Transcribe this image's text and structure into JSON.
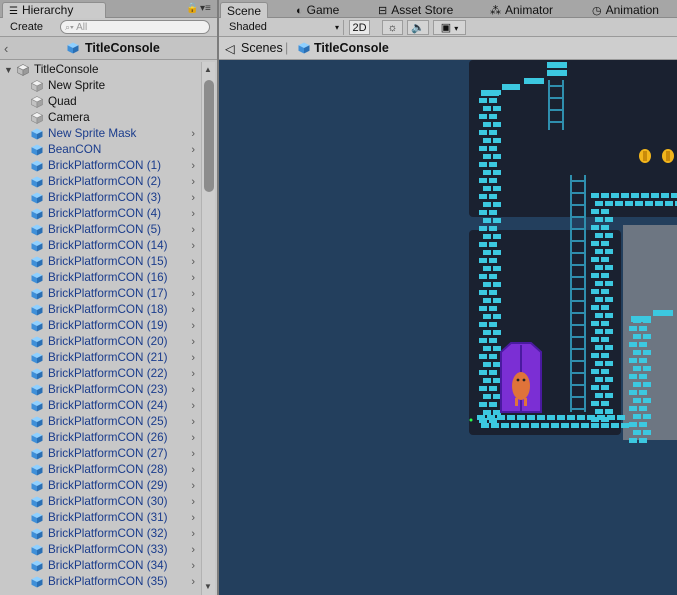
{
  "hierarchy": {
    "tab_label": "Hierarchy",
    "create_label": "Create",
    "search_placeholder": "All",
    "scene_title": "TitleConsole",
    "root": "TitleConsole",
    "items": [
      {
        "label": "New Sprite",
        "icon": "gameobject-icon",
        "has_children": false
      },
      {
        "label": "Quad",
        "icon": "gameobject-icon",
        "has_children": false
      },
      {
        "label": "Camera",
        "icon": "gameobject-icon",
        "has_children": false
      },
      {
        "label": "New Sprite Mask",
        "icon": "prefab-icon",
        "has_children": true
      },
      {
        "label": "BeanCON",
        "icon": "prefab-icon",
        "has_children": true
      },
      {
        "label": "BrickPlatformCON (1)",
        "icon": "prefab-icon",
        "has_children": true
      },
      {
        "label": "BrickPlatformCON (2)",
        "icon": "prefab-icon",
        "has_children": true
      },
      {
        "label": "BrickPlatformCON (3)",
        "icon": "prefab-icon",
        "has_children": true
      },
      {
        "label": "BrickPlatformCON (4)",
        "icon": "prefab-icon",
        "has_children": true
      },
      {
        "label": "BrickPlatformCON (5)",
        "icon": "prefab-icon",
        "has_children": true
      },
      {
        "label": "BrickPlatformCON (14)",
        "icon": "prefab-icon",
        "has_children": true
      },
      {
        "label": "BrickPlatformCON (15)",
        "icon": "prefab-icon",
        "has_children": true
      },
      {
        "label": "BrickPlatformCON (16)",
        "icon": "prefab-icon",
        "has_children": true
      },
      {
        "label": "BrickPlatformCON (17)",
        "icon": "prefab-icon",
        "has_children": true
      },
      {
        "label": "BrickPlatformCON (18)",
        "icon": "prefab-icon",
        "has_children": true
      },
      {
        "label": "BrickPlatformCON (19)",
        "icon": "prefab-icon",
        "has_children": true
      },
      {
        "label": "BrickPlatformCON (20)",
        "icon": "prefab-icon",
        "has_children": true
      },
      {
        "label": "BrickPlatformCON (21)",
        "icon": "prefab-icon",
        "has_children": true
      },
      {
        "label": "BrickPlatformCON (22)",
        "icon": "prefab-icon",
        "has_children": true
      },
      {
        "label": "BrickPlatformCON (23)",
        "icon": "prefab-icon",
        "has_children": true
      },
      {
        "label": "BrickPlatformCON (24)",
        "icon": "prefab-icon",
        "has_children": true
      },
      {
        "label": "BrickPlatformCON (25)",
        "icon": "prefab-icon",
        "has_children": true
      },
      {
        "label": "BrickPlatformCON (26)",
        "icon": "prefab-icon",
        "has_children": true
      },
      {
        "label": "BrickPlatformCON (27)",
        "icon": "prefab-icon",
        "has_children": true
      },
      {
        "label": "BrickPlatformCON (28)",
        "icon": "prefab-icon",
        "has_children": true
      },
      {
        "label": "BrickPlatformCON (29)",
        "icon": "prefab-icon",
        "has_children": true
      },
      {
        "label": "BrickPlatformCON (30)",
        "icon": "prefab-icon",
        "has_children": true
      },
      {
        "label": "BrickPlatformCON (31)",
        "icon": "prefab-icon",
        "has_children": true
      },
      {
        "label": "BrickPlatformCON (32)",
        "icon": "prefab-icon",
        "has_children": true
      },
      {
        "label": "BrickPlatformCON (33)",
        "icon": "prefab-icon",
        "has_children": true
      },
      {
        "label": "BrickPlatformCON (34)",
        "icon": "prefab-icon",
        "has_children": true
      },
      {
        "label": "BrickPlatformCON (35)",
        "icon": "prefab-icon",
        "has_children": true
      }
    ]
  },
  "scene_view": {
    "tabs": [
      {
        "label": "Scene",
        "icon": "scene-icon",
        "active": true
      },
      {
        "label": "Game",
        "icon": "game-icon",
        "active": false
      },
      {
        "label": "Asset Store",
        "icon": "asset-store-icon",
        "active": false
      },
      {
        "label": "Animator",
        "icon": "animator-icon",
        "active": false
      },
      {
        "label": "Animation",
        "icon": "animation-icon",
        "active": false
      }
    ],
    "shading_mode": "Shaded",
    "mode_2d_label": "2D",
    "breadcrumbs": {
      "root": "Scenes",
      "current": "TitleConsole"
    }
  },
  "colors": {
    "prefab_text": "#1a3c8c",
    "viewport_bg": "#233f5d",
    "brick": "#3cc8e0",
    "room_bg": "#1a2130",
    "door": "#7b2fd4",
    "coin": "#f2b51c"
  }
}
